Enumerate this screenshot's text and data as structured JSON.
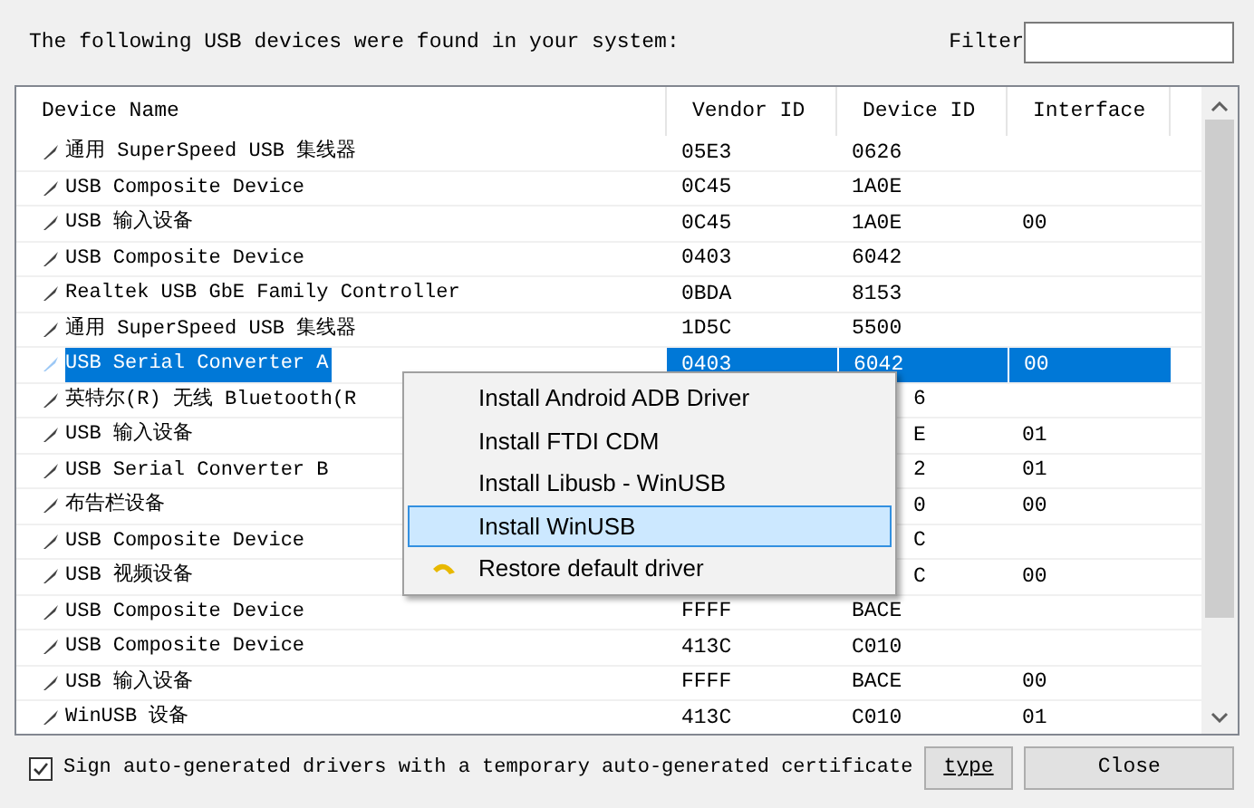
{
  "header": {
    "prompt": "The following USB devices were found in your system:",
    "filter_label": "Filter"
  },
  "table": {
    "columns": [
      "Device Name",
      "Vendor ID",
      "Device ID",
      "Interface"
    ],
    "rows": [
      {
        "name": "通用 SuperSpeed USB 集线器",
        "vendor": "05E3",
        "device": "0626",
        "interface": "",
        "selected": false,
        "covered": false
      },
      {
        "name": "USB Composite Device",
        "vendor": "0C45",
        "device": "1A0E",
        "interface": "",
        "selected": false,
        "covered": false
      },
      {
        "name": "USB 输入设备",
        "vendor": "0C45",
        "device": "1A0E",
        "interface": "00",
        "selected": false,
        "covered": false
      },
      {
        "name": "USB Composite Device",
        "vendor": "0403",
        "device": "6042",
        "interface": "",
        "selected": false,
        "covered": false
      },
      {
        "name": "Realtek USB GbE Family Controller",
        "vendor": "0BDA",
        "device": "8153",
        "interface": "",
        "selected": false,
        "covered": false
      },
      {
        "name": "通用 SuperSpeed USB 集线器",
        "vendor": "1D5C",
        "device": "5500",
        "interface": "",
        "selected": false,
        "covered": false
      },
      {
        "name": "USB Serial Converter A",
        "vendor": "0403",
        "device": "6042",
        "interface": "00",
        "selected": true,
        "covered": false
      },
      {
        "name": "英特尔(R) 无线 Bluetooth(R",
        "vendor": "",
        "device": "6",
        "interface": "",
        "selected": false,
        "covered": true
      },
      {
        "name": "USB 输入设备",
        "vendor": "",
        "device": "E",
        "interface": "01",
        "selected": false,
        "covered": true
      },
      {
        "name": "USB Serial Converter B",
        "vendor": "",
        "device": "2",
        "interface": "01",
        "selected": false,
        "covered": true
      },
      {
        "name": "布告栏设备",
        "vendor": "",
        "device": "0",
        "interface": "00",
        "selected": false,
        "covered": true
      },
      {
        "name": "USB Composite Device",
        "vendor": "",
        "device": "C",
        "interface": "",
        "selected": false,
        "covered": true
      },
      {
        "name": "USB 视频设备",
        "vendor": "",
        "device": "C",
        "interface": "00",
        "selected": false,
        "covered": true
      },
      {
        "name": "USB Composite Device",
        "vendor": "FFFF",
        "device": "BACE",
        "interface": "",
        "selected": false,
        "covered": false
      },
      {
        "name": "USB Composite Device",
        "vendor": "413C",
        "device": "C010",
        "interface": "",
        "selected": false,
        "covered": false
      },
      {
        "name": "USB 输入设备",
        "vendor": "FFFF",
        "device": "BACE",
        "interface": "00",
        "selected": false,
        "covered": false
      },
      {
        "name": "WinUSB 设备",
        "vendor": "413C",
        "device": "C010",
        "interface": "01",
        "selected": false,
        "covered": false
      }
    ]
  },
  "context_menu": {
    "items": [
      {
        "label": "Install Android ADB Driver",
        "selected": false,
        "kind": "plain"
      },
      {
        "label": "Install FTDI CDM",
        "selected": false,
        "kind": "plain"
      },
      {
        "label": "Install Libusb - WinUSB",
        "selected": false,
        "kind": "plain"
      },
      {
        "label": "Install WinUSB",
        "selected": true,
        "kind": "plain"
      },
      {
        "label": "Restore default driver",
        "selected": false,
        "kind": "restore"
      }
    ]
  },
  "footer": {
    "sign_checkbox": {
      "label": "Sign auto-generated drivers with a temporary auto-generated certificate",
      "checked": true
    },
    "type_button": "type",
    "close_button": "Close"
  }
}
